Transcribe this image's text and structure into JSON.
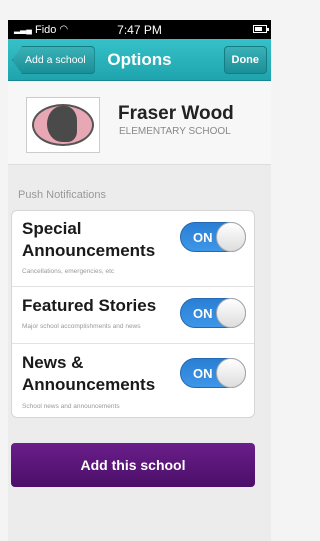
{
  "status_bar": {
    "carrier": "Fido",
    "time": "7:47 PM"
  },
  "navbar": {
    "back_label": "Add a school",
    "title": "Options",
    "done_label": "Done"
  },
  "school": {
    "name": "Fraser Wood",
    "type": "ELEMENTARY SCHOOL"
  },
  "push": {
    "header": "Push Notifications",
    "items": [
      {
        "title_line1": "Special",
        "title_line2": "Announcements",
        "subtitle": "Cancellations, emergencies, etc",
        "toggle": "ON"
      },
      {
        "title_line1": "Featured Stories",
        "subtitle": "Major school accomplishments and news",
        "toggle": "ON"
      },
      {
        "title_line1": "News &",
        "title_line2": "Announcements",
        "subtitle": "School news and announcements",
        "toggle": "ON"
      }
    ]
  },
  "actions": {
    "add_label": "Add this school"
  },
  "colors": {
    "accent": "#1fa4ad",
    "toggle": "#2a7fd4",
    "button": "#4b0f68"
  }
}
